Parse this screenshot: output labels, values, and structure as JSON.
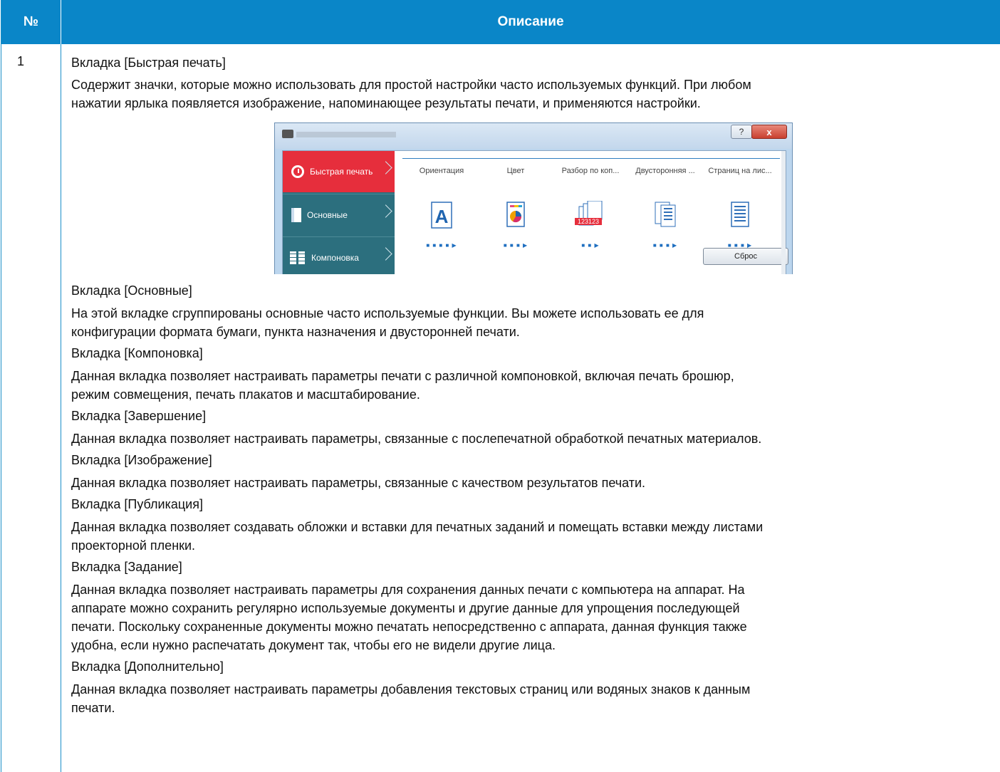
{
  "table": {
    "header": {
      "col_num": "№",
      "col_desc": "Описание"
    },
    "row_num": "1",
    "paragraphs": [
      "Вкладка [Быстрая печать]",
      "Содержит значки, которые можно использовать для простой настройки часто используемых функций. При любом",
      "нажатии ярлыка появляется изображение, напоминающее результаты печати, и применяются настройки.",
      "Вкладка [Основные]",
      "На этой вкладке сгруппированы основные часто используемые функции. Вы можете использовать ее для",
      "конфигурации формата бумаги, пункта назначения и двусторонней печати.",
      "Вкладка [Компоновка]",
      "Данная вкладка позволяет настраивать параметры печати с различной компоновкой, включая печать брошюр,",
      "режим совмещения, печать плакатов и масштабирование.",
      "Вкладка [Завершение]",
      "Данная вкладка позволяет настраивать параметры, связанные с послепечатной обработкой печатных материалов.",
      "Вкладка [Изображение]",
      "Данная вкладка позволяет настраивать параметры, связанные с качеством результатов печати.",
      "Вкладка [Публикация]",
      "Данная вкладка позволяет создавать обложки и вставки для печатных заданий и помещать вставки между листами",
      "проекторной пленки.",
      "Вкладка [Задание]",
      "Данная вкладка позволяет настраивать параметры для сохранения данных печати с компьютера на аппарат. На",
      "аппарате можно сохранить регулярно используемые документы и другие данные для упрощения последующей",
      "печати. Поскольку сохраненные документы можно печатать непосредственно с аппарата, данная функция также",
      "удобна, если нужно распечатать документ так, чтобы его не видели другие лица.",
      "Вкладка [Дополнительно]",
      "Данная вкладка позволяет настраивать параметры добавления текстовых страниц или водяных знаков к данным",
      "печати."
    ]
  },
  "dialog": {
    "help_label": "?",
    "close_label": "x",
    "sidebar": [
      {
        "label": "Быстрая печать",
        "icon": "stopwatch-icon"
      },
      {
        "label": "Основные",
        "icon": "page-icon"
      },
      {
        "label": "Компоновка",
        "icon": "layout-grid-icon"
      }
    ],
    "columns": [
      "Ориентация",
      "Цвет",
      "Разбор по коп...",
      "Двусторонняя ...",
      "Страниц на лис..."
    ],
    "orientation_icon_text": "A",
    "collate_icon_text": "123123",
    "reset_label": "Сброс",
    "colors": {
      "accent": "#e62e3c",
      "sidebar": "#2c6f7e",
      "header": "#0a86c8",
      "link": "#1f6fc0"
    }
  }
}
